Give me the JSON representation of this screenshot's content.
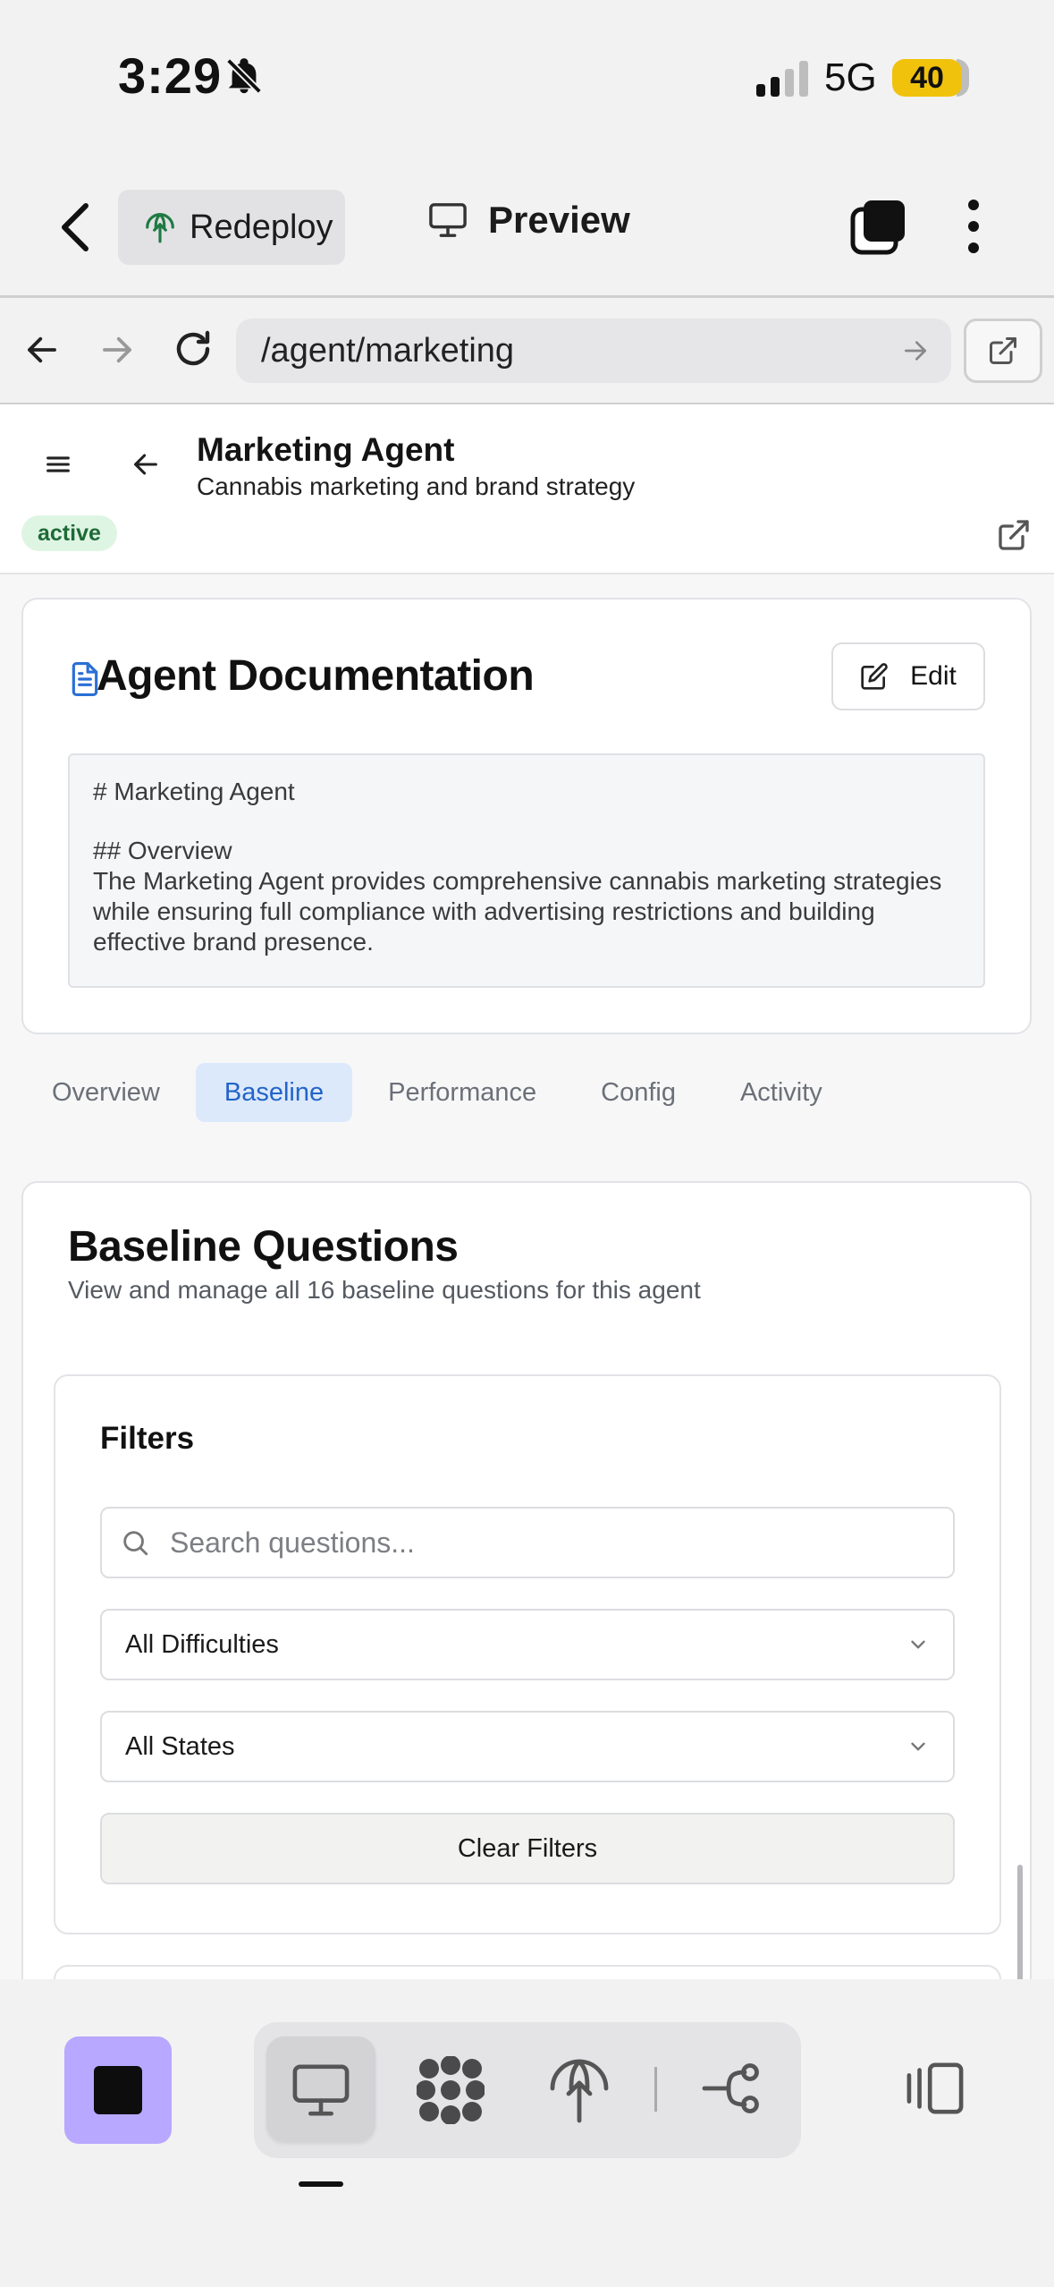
{
  "status_bar": {
    "time": "3:29",
    "network": "5G",
    "battery": "40"
  },
  "toolbar": {
    "redeploy_label": "Redeploy",
    "preview_label": "Preview"
  },
  "browser": {
    "url": "/agent/marketing"
  },
  "agent": {
    "name": "Marketing Agent",
    "description": "Cannabis marketing and brand strategy",
    "status": "active"
  },
  "documentation": {
    "title": "Agent Documentation",
    "edit_label": "Edit",
    "lines": [
      "# Marketing Agent",
      "",
      "## Overview",
      "The Marketing Agent provides comprehensive cannabis marketing strategies while ensuring full compliance with advertising restrictions and building effective brand presence."
    ]
  },
  "tabs": [
    {
      "label": "Overview",
      "active": false
    },
    {
      "label": "Baseline",
      "active": true
    },
    {
      "label": "Performance",
      "active": false
    },
    {
      "label": "Config",
      "active": false
    },
    {
      "label": "Activity",
      "active": false
    }
  ],
  "baseline": {
    "title": "Baseline Questions",
    "subtitle": "View and manage all 16 baseline questions for this agent",
    "filters": {
      "title": "Filters",
      "search_placeholder": "Search questions...",
      "difficulty": "All Difficulties",
      "state": "All States",
      "clear_label": "Clear Filters"
    }
  },
  "colors": {
    "accent": "#2364c8",
    "active_tab_bg": "#dce9fb",
    "badge_bg": "#dff5e4",
    "badge_text": "#1e6a37",
    "stop_button": "#b8a8ff",
    "battery": "#f0c20c"
  },
  "icons": [
    "bell-slash-icon",
    "signal-icon",
    "back-chevron-icon",
    "antenna-icon",
    "monitor-icon",
    "tabs-icon",
    "more-vertical-icon",
    "arrow-left-icon",
    "arrow-right-icon",
    "reload-icon",
    "external-link-icon",
    "hamburger-icon",
    "document-icon",
    "edit-icon",
    "search-icon",
    "chevron-down-icon",
    "grid-dots-icon",
    "flow-icon",
    "sidebar-icon"
  ]
}
